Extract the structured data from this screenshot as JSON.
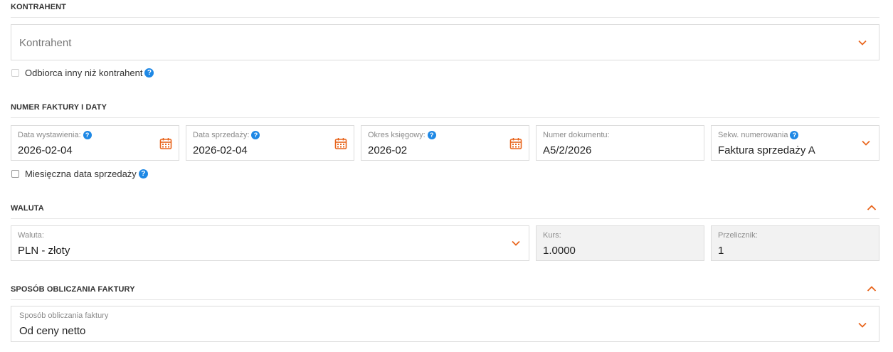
{
  "kontrahent_section": {
    "title": "KONTRAHENT",
    "select_placeholder": "Kontrahent",
    "checkbox_label": "Odbiorca inny niż kontrahent"
  },
  "numer_section": {
    "title": "NUMER FAKTURY I DATY",
    "fields": [
      {
        "label": "Data wystawienia:",
        "value": "2026-02-04"
      },
      {
        "label": "Data sprzedaży:",
        "value": "2026-02-04"
      },
      {
        "label": "Okres księgowy:",
        "value": "2026-02"
      },
      {
        "label": "Numer dokumentu:",
        "value": "A5/2/2026"
      },
      {
        "label": "Sekw. numerowania",
        "value": "Faktura sprzedaży A"
      }
    ],
    "checkbox_label": "Miesięczna data sprzedaży"
  },
  "waluta_section": {
    "title": "WALUTA",
    "waluta": {
      "label": "Waluta:",
      "value": "PLN - złoty"
    },
    "kurs": {
      "label": "Kurs:",
      "value": "1.0000"
    },
    "przelicznik": {
      "label": "Przelicznik:",
      "value": "1"
    }
  },
  "sposob_section": {
    "title": "SPOSÓB OBLICZANIA FAKTURY",
    "field": {
      "label": "Sposób obliczania faktury",
      "value": "Od ceny netto"
    }
  },
  "icons": {
    "help": "?",
    "help_color": "#1e88e5",
    "accent": "#e8641b"
  }
}
